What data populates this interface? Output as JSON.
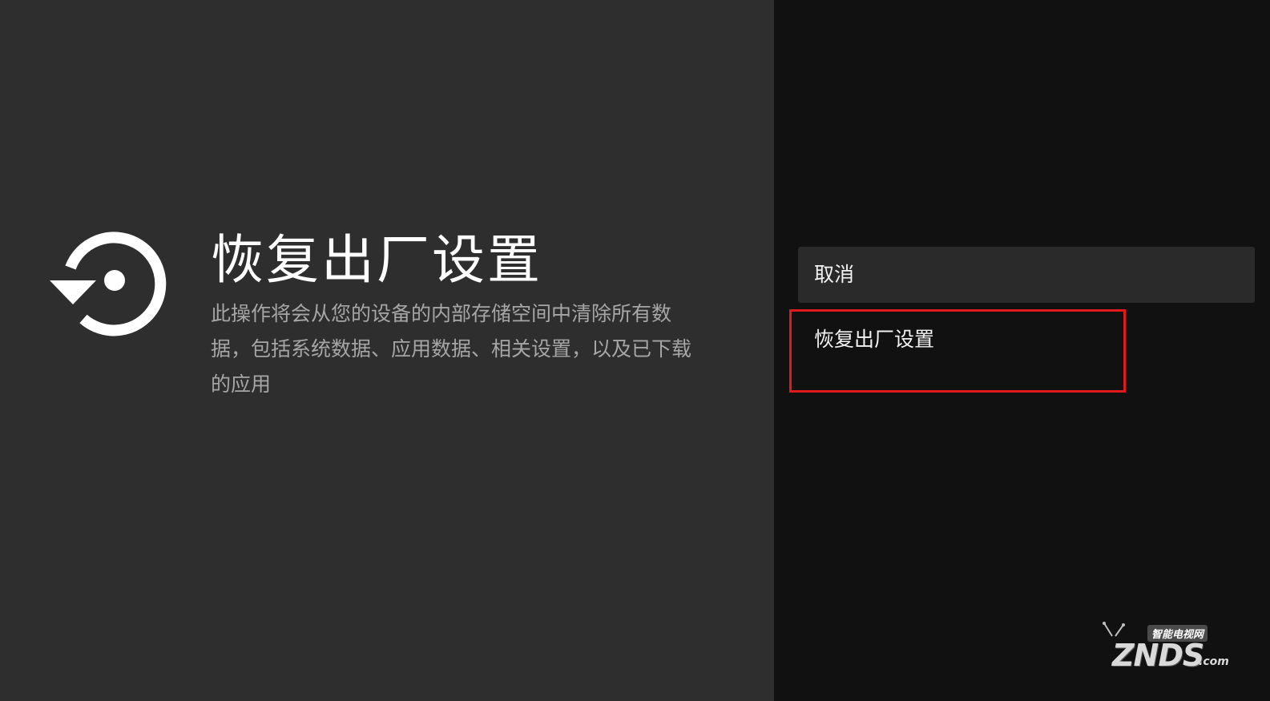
{
  "screen": {
    "title": "恢复出厂设置",
    "description": "此操作将会从您的设备的内部存储空间中清除所有数据，包括系统数据、应用数据、相关设置，以及已下载的应用",
    "icon": "factory-reset-icon"
  },
  "options": {
    "cancel_label": "取消",
    "reset_label": "恢复出厂设置"
  },
  "watermark": {
    "brand_cn": "智能电视网",
    "brand": "ZNDS",
    "suffix": ".com"
  },
  "colors": {
    "left_pane": "#2e2e2e",
    "right_pane": "#111111",
    "highlight": "#e01a1a"
  }
}
